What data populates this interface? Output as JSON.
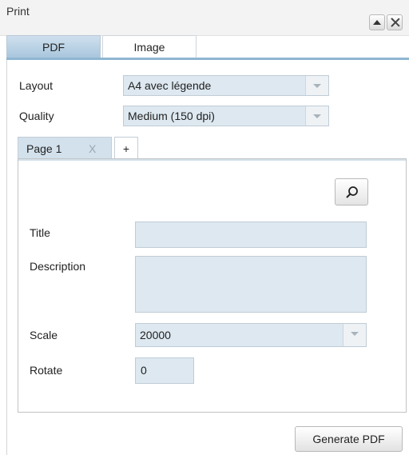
{
  "window": {
    "title": "Print",
    "controls": [
      "collapse-icon",
      "close-icon"
    ]
  },
  "main_tabs": [
    {
      "label": "PDF",
      "active": true
    },
    {
      "label": "Image",
      "active": false
    }
  ],
  "form": {
    "layout": {
      "label": "Layout",
      "value": "A4 avec légende"
    },
    "quality": {
      "label": "Quality",
      "value": "Medium (150 dpi)"
    }
  },
  "page_tabs": [
    {
      "label": "Page 1",
      "close": "X",
      "active": true
    },
    {
      "label": "+",
      "active": false
    }
  ],
  "page": {
    "zoom_icon": "search-icon",
    "title": {
      "label": "Title",
      "value": ""
    },
    "description": {
      "label": "Description",
      "value": ""
    },
    "scale": {
      "label": "Scale",
      "value": "20000"
    },
    "rotate": {
      "label": "Rotate",
      "value": "0"
    }
  },
  "actions": {
    "generate_label": "Generate PDF"
  },
  "colors": {
    "tab_active": "#a9c6dd",
    "field_bg": "#dde8f0",
    "accent_strip": "#8fb6d2"
  }
}
